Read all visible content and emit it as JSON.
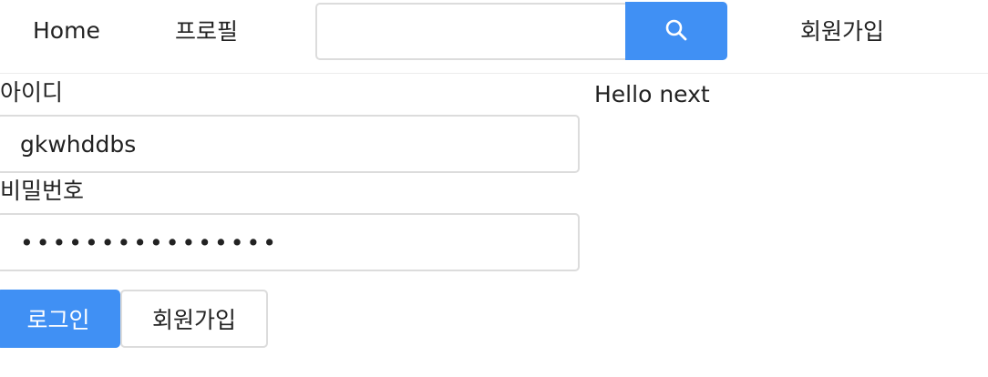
{
  "nav": {
    "home_label": "Home",
    "profile_label": "프로필",
    "search_value": "",
    "search_icon": "search-icon",
    "signup_label": "회원가입"
  },
  "login_form": {
    "id_label": "아이디",
    "id_value": "gkwhddbs",
    "password_label": "비밀번호",
    "password_value": "••••••••••••••••",
    "login_button_label": "로그인",
    "signup_button_label": "회원가입"
  },
  "content": {
    "greeting": "Hello next"
  },
  "colors": {
    "accent": "#4090f4",
    "border": "#dcdcdc",
    "text": "#222222"
  }
}
